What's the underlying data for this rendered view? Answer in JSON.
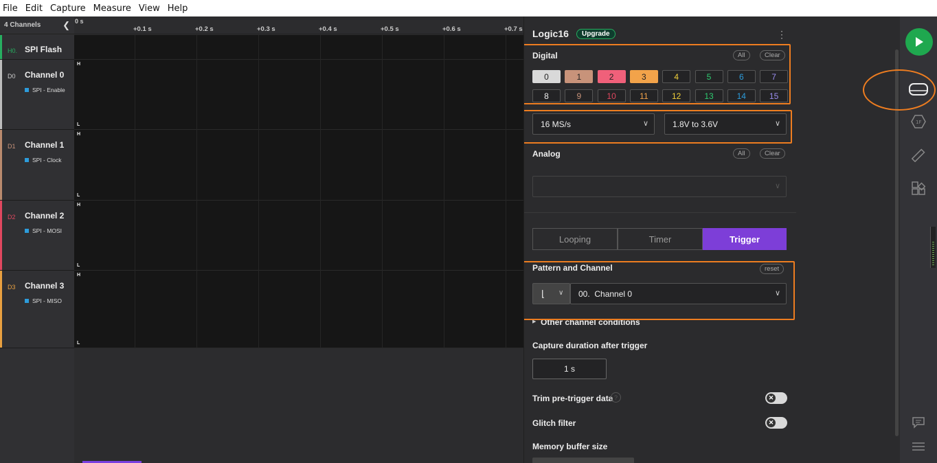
{
  "menu": [
    "File",
    "Edit",
    "Capture",
    "Measure",
    "View",
    "Help"
  ],
  "channels_panel": {
    "title": "4 Channels",
    "collapse_icon": "chevron-left-icon"
  },
  "channels": [
    {
      "code": "H0.",
      "name": "SPI Flash",
      "sub": "",
      "color": "#27ae60"
    },
    {
      "code": "D0",
      "name": "Channel 0",
      "sub": "SPI - Enable",
      "color": "#bdbdbd"
    },
    {
      "code": "D1",
      "name": "Channel 1",
      "sub": "SPI - Clock",
      "color": "#b98a6e"
    },
    {
      "code": "D2",
      "name": "Channel 2",
      "sub": "SPI - MOSI",
      "color": "#e0475f"
    },
    {
      "code": "D3",
      "name": "Channel 3",
      "sub": "SPI - MISO",
      "color": "#e8a040"
    }
  ],
  "ruler": {
    "zero": "0 s",
    "ticks": [
      "+0.1 s",
      "+0.2 s",
      "+0.3 s",
      "+0.4 s",
      "+0.5 s",
      "+0.6 s",
      "+0.7 s"
    ]
  },
  "levels": {
    "high": "H",
    "low": "L"
  },
  "device": {
    "name": "Logic16",
    "upgrade": "Upgrade"
  },
  "digital": {
    "label": "Digital",
    "all": "All",
    "clear": "Clear",
    "row1": [
      {
        "n": "0",
        "fg": "#222",
        "bg": "#d9d9d9"
      },
      {
        "n": "1",
        "fg": "#222",
        "bg": "#c8937a"
      },
      {
        "n": "2",
        "fg": "#222",
        "bg": "#f0607a"
      },
      {
        "n": "3",
        "fg": "#222",
        "bg": "#f2a34a"
      },
      {
        "n": "4",
        "fg": "#f2d13a",
        "bg": ""
      },
      {
        "n": "5",
        "fg": "#2ecc71",
        "bg": ""
      },
      {
        "n": "6",
        "fg": "#2d9cdb",
        "bg": ""
      },
      {
        "n": "7",
        "fg": "#9b8ef0",
        "bg": ""
      }
    ],
    "row2": [
      {
        "n": "8",
        "fg": "#eee",
        "bg": ""
      },
      {
        "n": "9",
        "fg": "#c8937a",
        "bg": ""
      },
      {
        "n": "10",
        "fg": "#e0475f",
        "bg": ""
      },
      {
        "n": "11",
        "fg": "#f2a34a",
        "bg": ""
      },
      {
        "n": "12",
        "fg": "#f2d13a",
        "bg": ""
      },
      {
        "n": "13",
        "fg": "#2ecc71",
        "bg": ""
      },
      {
        "n": "14",
        "fg": "#2d9cdb",
        "bg": ""
      },
      {
        "n": "15",
        "fg": "#9b8ef0",
        "bg": ""
      }
    ]
  },
  "sample_rate": "16 MS/s",
  "voltage": "1.8V to 3.6V",
  "analog": {
    "label": "Analog",
    "all": "All",
    "clear": "Clear",
    "placeholder": ""
  },
  "modes": {
    "looping": "Looping",
    "timer": "Timer",
    "trigger": "Trigger"
  },
  "trigger": {
    "label": "Pattern and Channel",
    "reset": "reset",
    "edge_symbol": "⌊",
    "channel": "00.  Channel 0",
    "other": "Other channel conditions"
  },
  "duration": {
    "label": "Capture duration after trigger",
    "value": "1 s"
  },
  "trim": {
    "label": "Trim pre-trigger data"
  },
  "glitch": {
    "label": "Glitch filter"
  },
  "memory": {
    "label": "Memory buffer size"
  },
  "colors": {
    "accent": "#7d3ed8",
    "highlight": "#ee7d20",
    "play": "#1fa84f"
  }
}
